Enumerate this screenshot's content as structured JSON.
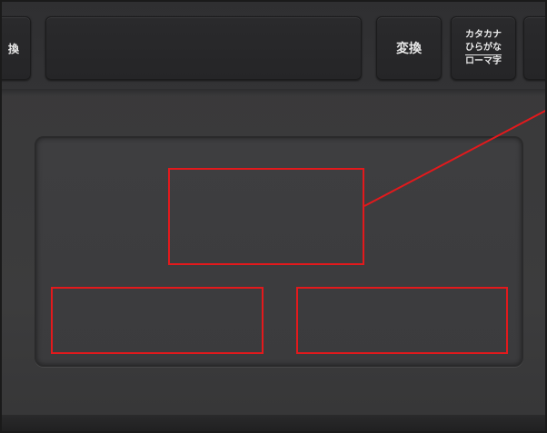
{
  "keyboard": {
    "left_key_label": "換",
    "henkan_label": "変換",
    "kana_key": {
      "line1": "カタカナ",
      "line2": "ひらがな",
      "line3": "ローマ字"
    }
  },
  "annotations": {
    "color": "#e3191c",
    "regions": [
      "touchpad-center-area",
      "left-click-area",
      "right-click-area"
    ]
  }
}
